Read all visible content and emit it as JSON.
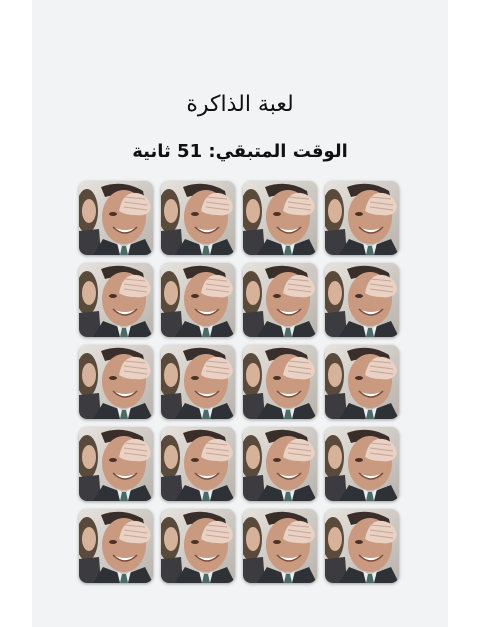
{
  "game": {
    "title": "لعبة الذاكرة",
    "timer_text": "الوقت المتبقي: 51 ثانية"
  },
  "grid": {
    "rows": 5,
    "columns": 4,
    "card_state": "face-down",
    "card_image": "man-covering-eye-photo"
  },
  "colors": {
    "panel_background": "#f1f3f5",
    "text": "#111111"
  }
}
